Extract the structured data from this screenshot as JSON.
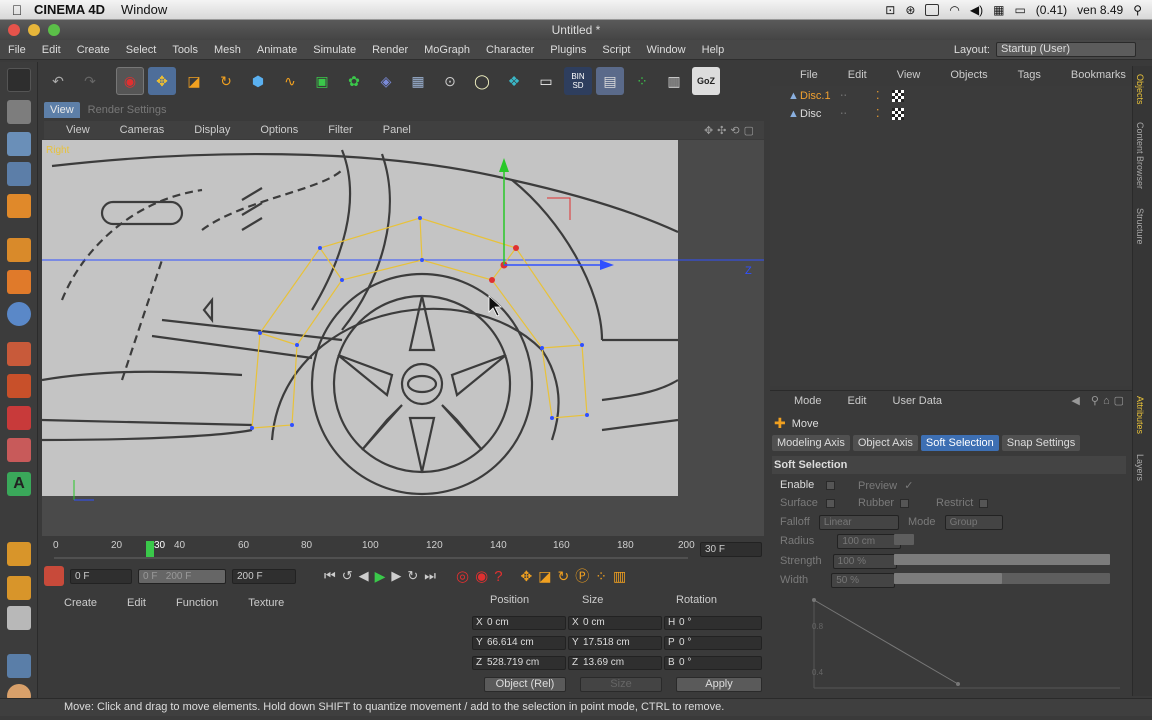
{
  "mac_menubar": {
    "app_name": "CINEMA 4D",
    "menu": "Window",
    "battery": "(0.41)",
    "clock": "ven 8.49"
  },
  "window": {
    "title": "Untitled *"
  },
  "main_menu": {
    "items": [
      "File",
      "Edit",
      "Create",
      "Select",
      "Tools",
      "Mesh",
      "Animate",
      "Simulate",
      "Render",
      "MoGraph",
      "Character",
      "Plugins",
      "Script",
      "Window",
      "Help"
    ],
    "layout_label": "Layout:",
    "layout_value": "Startup (User)"
  },
  "toolbar_icons": [
    "undo-icon",
    "redo-icon",
    "live-selection-icon",
    "move-icon",
    "scale-icon",
    "rotate-icon",
    "cube-icon",
    "spline-icon",
    "nurbs-icon",
    "array-icon",
    "deformer-icon",
    "floor-icon",
    "camera-icon",
    "light-icon",
    "render-view-icon",
    "render-region-icon",
    "render-settings-icon",
    "bin-sd-icon",
    "layer-icon",
    "mograph-icon",
    "goz-icon"
  ],
  "toolbar_text": {
    "goz": "GoZ",
    "bin": "BIN",
    "sd": "SD"
  },
  "viewport": {
    "tabs": [
      "View",
      "Render Settings"
    ],
    "menu": [
      "View",
      "Cameras",
      "Display",
      "Options",
      "Filter",
      "Panel"
    ],
    "label": "Right",
    "axis_label": "Z"
  },
  "timeline": {
    "ticks": [
      "0",
      "20",
      "30",
      "40",
      "60",
      "80",
      "100",
      "120",
      "140",
      "160",
      "180",
      "200"
    ],
    "current": "30",
    "end_field": "30 F"
  },
  "transport": {
    "start": "0 F",
    "range_start": "0 F",
    "range_end": "200 F",
    "end": "200 F"
  },
  "material_menu": [
    "Create",
    "Edit",
    "Function",
    "Texture"
  ],
  "coordinates": {
    "headers": {
      "position": "Position",
      "size": "Size",
      "rotation": "Rotation"
    },
    "rows": [
      {
        "pos_axis": "X",
        "pos": "0 cm",
        "size_axis": "X",
        "size": "0 cm",
        "rot_axis": "H",
        "rot": "0 °"
      },
      {
        "pos_axis": "Y",
        "pos": "66.614 cm",
        "size_axis": "Y",
        "size": "17.518 cm",
        "rot_axis": "P",
        "rot": "0 °"
      },
      {
        "pos_axis": "Z",
        "pos": "528.719 cm",
        "size_axis": "Z",
        "size": "13.69 cm",
        "rot_axis": "B",
        "rot": "0 °"
      }
    ],
    "mode": "Object (Rel)",
    "size_mode": "Size",
    "apply": "Apply"
  },
  "status_text": "Move: Click and drag to move elements. Hold down SHIFT to quantize movement / add to the selection in point mode, CTRL to remove.",
  "objects": {
    "menu": [
      "File",
      "Edit",
      "View",
      "Objects",
      "Tags",
      "Bookmarks"
    ],
    "items": [
      {
        "name": "Disc.1",
        "selected": true
      },
      {
        "name": "Disc",
        "selected": false
      }
    ]
  },
  "side_tabs": [
    "Objects",
    "Content Browser",
    "Structure"
  ],
  "attr_side_tabs": [
    "Attributes",
    "Layers"
  ],
  "attributes": {
    "menu": [
      "Mode",
      "Edit",
      "User Data"
    ],
    "tool": "Move",
    "tabs": [
      "Modeling Axis",
      "Object Axis",
      "Soft Selection",
      "Snap Settings"
    ],
    "active_tab": "Soft Selection",
    "section": "Soft Selection",
    "enable": "Enable",
    "preview": "Preview",
    "preview_check": "✓",
    "surface": "Surface",
    "rubber": "Rubber",
    "restrict": "Restrict",
    "falloff": "Falloff",
    "falloff_value": "Linear",
    "mode": "Mode",
    "mode_value": "Group",
    "radius": "Radius",
    "radius_value": "100 cm",
    "strength": "Strength",
    "strength_value": "100 %",
    "strength_fraction": 1.0,
    "width": "Width",
    "width_value": "50 %",
    "width_fraction": 0.5,
    "graph_labels": [
      "0.8",
      "0.4"
    ]
  },
  "colors": {
    "accent_blue": "#3d6fb3",
    "selection_yellow": "#e8c23a",
    "object_selected": "#f0a030",
    "axis_green": "#28c828",
    "axis_blue": "#3050ff",
    "axis_red": "#e03030"
  }
}
